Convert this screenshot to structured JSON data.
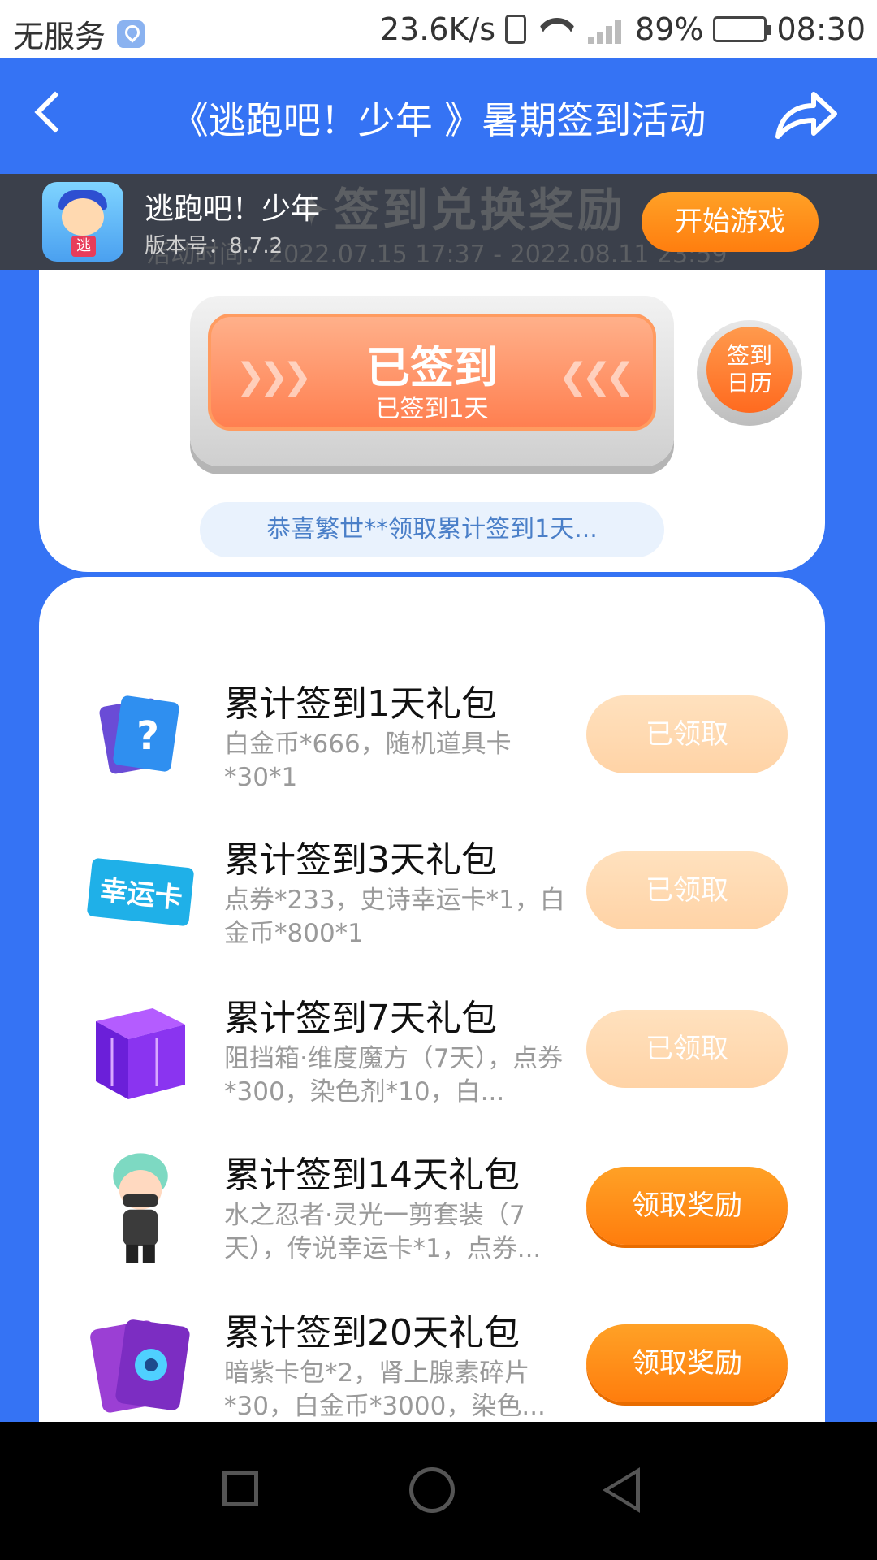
{
  "status_bar": {
    "carrier": "无服务",
    "speed": "23.6K/s",
    "battery": "89%",
    "time": "08:30",
    "icons": [
      "location-icon",
      "vibrate-icon",
      "wifi-icon",
      "signal-icon",
      "battery-icon"
    ]
  },
  "header": {
    "title": "《逃跑吧！少年 》暑期签到活动",
    "back_icon": "chevron-left-icon",
    "share_icon": "share-icon"
  },
  "banner_ghost": {
    "title": "✦签到兑换奖励 ✦",
    "time": "活动时间：2022.07.15 17:37 - 2022.08.11 23:59"
  },
  "app": {
    "name": "逃跑吧！少年",
    "version": "版本号：8.7.2",
    "icon_badge": "逃",
    "start_label": "开始游戏"
  },
  "checkin": {
    "status": "已签到",
    "sub": "已签到1天",
    "calendar_label": "签到\n日历"
  },
  "notice": "恭喜繁世**领取累计签到1天...",
  "rewards": [
    {
      "title": "累计签到1天礼包",
      "desc": "白金币*666，随机道具卡*30*1",
      "button": "已领取",
      "state": "claimed",
      "icon": "mystery-card-icon"
    },
    {
      "title": "累计签到3天礼包",
      "desc": "点券*233，史诗幸运卡*1，白金币*800*1",
      "button": "已领取",
      "state": "claimed",
      "icon": "lucky-card-icon",
      "icon_text": "幸运卡"
    },
    {
      "title": "累计签到7天礼包",
      "desc": "阻挡箱·维度魔方（7天），点券*300，染色剂*10，白...",
      "button": "已领取",
      "state": "claimed",
      "icon": "purple-cube-icon"
    },
    {
      "title": "累计签到14天礼包",
      "desc": "水之忍者·灵光一剪套装（7天），传说幸运卡*1，点券...",
      "button": "领取奖励",
      "state": "active",
      "icon": "ninja-character-icon"
    },
    {
      "title": "累计签到20天礼包",
      "desc": "暗紫卡包*2，肾上腺素碎片*30，白金币*3000，染色...",
      "button": "领取奖励",
      "state": "active",
      "icon": "card-pack-icon"
    }
  ],
  "colors": {
    "primary_blue": "#3573f4",
    "orange": "#ff8a1a",
    "claimed": "#ffd9b3"
  }
}
